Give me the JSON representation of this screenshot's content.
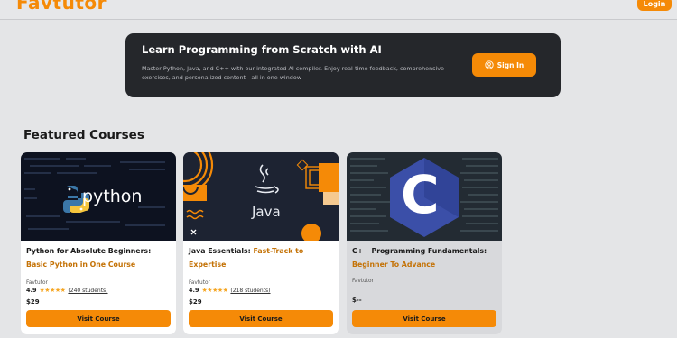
{
  "header": {
    "logo": "Favtutor",
    "login_label": "Login"
  },
  "hero": {
    "title": "Learn Programming from Scratch with AI",
    "description": "Master Python, Java, and C++ with our integrated AI compiler. Enjoy real-time feedback, comprehensive exercises, and personalized content—all in one window",
    "signin_label": "Sign In"
  },
  "section": {
    "title": "Featured Courses"
  },
  "courses": [
    {
      "title_plain": "Python for Absolute Beginners: ",
      "title_highlight": "Basic Python in One Course",
      "image_label": "python",
      "provider": "Favtutor",
      "rating": "4.9",
      "stars": "★★★★★",
      "students": "(240 students)",
      "price": "$29",
      "button": "Visit Course"
    },
    {
      "title_plain": "Java Essentials: ",
      "title_highlight": "Fast-Track to Expertise",
      "image_label": "Java",
      "provider": "Favtutor",
      "rating": "4.9",
      "stars": "★★★★★",
      "students": "(218 students)",
      "price": "$29",
      "button": "Visit Course"
    },
    {
      "title_plain": "C++ Programming Fundamentals: ",
      "title_highlight": "Beginner To Advance",
      "image_label": "C",
      "provider": "Favtutor",
      "price": "$--",
      "button": "Visit Course"
    }
  ],
  "colors": {
    "accent": "#f58a07",
    "hero_bg": "#25272b",
    "page_bg": "#e4e5e7"
  }
}
